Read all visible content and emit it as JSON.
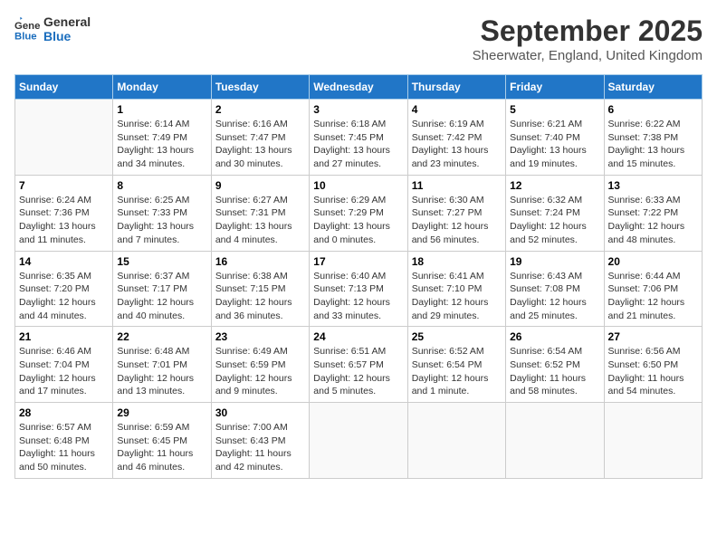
{
  "logo": {
    "line1": "General",
    "line2": "Blue"
  },
  "title": "September 2025",
  "location": "Sheerwater, England, United Kingdom",
  "days_of_week": [
    "Sunday",
    "Monday",
    "Tuesday",
    "Wednesday",
    "Thursday",
    "Friday",
    "Saturday"
  ],
  "weeks": [
    [
      {
        "day": "",
        "info": ""
      },
      {
        "day": "1",
        "info": "Sunrise: 6:14 AM\nSunset: 7:49 PM\nDaylight: 13 hours\nand 34 minutes."
      },
      {
        "day": "2",
        "info": "Sunrise: 6:16 AM\nSunset: 7:47 PM\nDaylight: 13 hours\nand 30 minutes."
      },
      {
        "day": "3",
        "info": "Sunrise: 6:18 AM\nSunset: 7:45 PM\nDaylight: 13 hours\nand 27 minutes."
      },
      {
        "day": "4",
        "info": "Sunrise: 6:19 AM\nSunset: 7:42 PM\nDaylight: 13 hours\nand 23 minutes."
      },
      {
        "day": "5",
        "info": "Sunrise: 6:21 AM\nSunset: 7:40 PM\nDaylight: 13 hours\nand 19 minutes."
      },
      {
        "day": "6",
        "info": "Sunrise: 6:22 AM\nSunset: 7:38 PM\nDaylight: 13 hours\nand 15 minutes."
      }
    ],
    [
      {
        "day": "7",
        "info": "Sunrise: 6:24 AM\nSunset: 7:36 PM\nDaylight: 13 hours\nand 11 minutes."
      },
      {
        "day": "8",
        "info": "Sunrise: 6:25 AM\nSunset: 7:33 PM\nDaylight: 13 hours\nand 7 minutes."
      },
      {
        "day": "9",
        "info": "Sunrise: 6:27 AM\nSunset: 7:31 PM\nDaylight: 13 hours\nand 4 minutes."
      },
      {
        "day": "10",
        "info": "Sunrise: 6:29 AM\nSunset: 7:29 PM\nDaylight: 13 hours\nand 0 minutes."
      },
      {
        "day": "11",
        "info": "Sunrise: 6:30 AM\nSunset: 7:27 PM\nDaylight: 12 hours\nand 56 minutes."
      },
      {
        "day": "12",
        "info": "Sunrise: 6:32 AM\nSunset: 7:24 PM\nDaylight: 12 hours\nand 52 minutes."
      },
      {
        "day": "13",
        "info": "Sunrise: 6:33 AM\nSunset: 7:22 PM\nDaylight: 12 hours\nand 48 minutes."
      }
    ],
    [
      {
        "day": "14",
        "info": "Sunrise: 6:35 AM\nSunset: 7:20 PM\nDaylight: 12 hours\nand 44 minutes."
      },
      {
        "day": "15",
        "info": "Sunrise: 6:37 AM\nSunset: 7:17 PM\nDaylight: 12 hours\nand 40 minutes."
      },
      {
        "day": "16",
        "info": "Sunrise: 6:38 AM\nSunset: 7:15 PM\nDaylight: 12 hours\nand 36 minutes."
      },
      {
        "day": "17",
        "info": "Sunrise: 6:40 AM\nSunset: 7:13 PM\nDaylight: 12 hours\nand 33 minutes."
      },
      {
        "day": "18",
        "info": "Sunrise: 6:41 AM\nSunset: 7:10 PM\nDaylight: 12 hours\nand 29 minutes."
      },
      {
        "day": "19",
        "info": "Sunrise: 6:43 AM\nSunset: 7:08 PM\nDaylight: 12 hours\nand 25 minutes."
      },
      {
        "day": "20",
        "info": "Sunrise: 6:44 AM\nSunset: 7:06 PM\nDaylight: 12 hours\nand 21 minutes."
      }
    ],
    [
      {
        "day": "21",
        "info": "Sunrise: 6:46 AM\nSunset: 7:04 PM\nDaylight: 12 hours\nand 17 minutes."
      },
      {
        "day": "22",
        "info": "Sunrise: 6:48 AM\nSunset: 7:01 PM\nDaylight: 12 hours\nand 13 minutes."
      },
      {
        "day": "23",
        "info": "Sunrise: 6:49 AM\nSunset: 6:59 PM\nDaylight: 12 hours\nand 9 minutes."
      },
      {
        "day": "24",
        "info": "Sunrise: 6:51 AM\nSunset: 6:57 PM\nDaylight: 12 hours\nand 5 minutes."
      },
      {
        "day": "25",
        "info": "Sunrise: 6:52 AM\nSunset: 6:54 PM\nDaylight: 12 hours\nand 1 minute."
      },
      {
        "day": "26",
        "info": "Sunrise: 6:54 AM\nSunset: 6:52 PM\nDaylight: 11 hours\nand 58 minutes."
      },
      {
        "day": "27",
        "info": "Sunrise: 6:56 AM\nSunset: 6:50 PM\nDaylight: 11 hours\nand 54 minutes."
      }
    ],
    [
      {
        "day": "28",
        "info": "Sunrise: 6:57 AM\nSunset: 6:48 PM\nDaylight: 11 hours\nand 50 minutes."
      },
      {
        "day": "29",
        "info": "Sunrise: 6:59 AM\nSunset: 6:45 PM\nDaylight: 11 hours\nand 46 minutes."
      },
      {
        "day": "30",
        "info": "Sunrise: 7:00 AM\nSunset: 6:43 PM\nDaylight: 11 hours\nand 42 minutes."
      },
      {
        "day": "",
        "info": ""
      },
      {
        "day": "",
        "info": ""
      },
      {
        "day": "",
        "info": ""
      },
      {
        "day": "",
        "info": ""
      }
    ]
  ]
}
